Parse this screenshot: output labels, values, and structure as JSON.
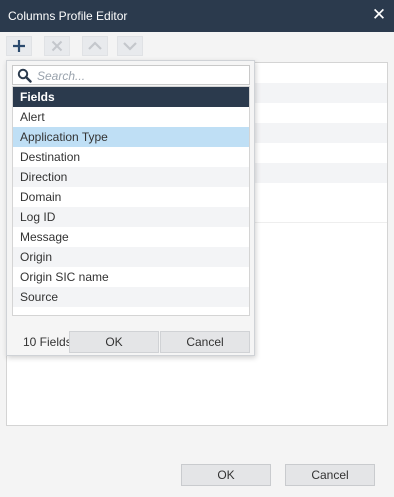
{
  "window": {
    "title": "Columns Profile Editor",
    "close_glyph": "✕"
  },
  "toolbar": {
    "buttons": [
      {
        "name": "add-icon",
        "enabled": true
      },
      {
        "name": "remove-icon",
        "enabled": false
      },
      {
        "name": "move-up-icon",
        "enabled": false
      },
      {
        "name": "move-down-icon",
        "enabled": false
      }
    ]
  },
  "popup": {
    "search": {
      "placeholder": "Search...",
      "value": ""
    },
    "list_header": "Fields",
    "fields": [
      "Alert",
      "Application Type",
      "Destination",
      "Direction",
      "Domain",
      "Log ID",
      "Message",
      "Origin",
      "Origin SIC name",
      "Source"
    ],
    "selected_field": "Application Type",
    "count_label": "10 Fields",
    "ok_label": "OK",
    "cancel_label": "Cancel"
  },
  "footer": {
    "ok_label": "OK",
    "cancel_label": "Cancel"
  },
  "colors": {
    "titlebar": "#2b3a4d",
    "selection": "#bfdff5",
    "add_icon": "#2b4a6e",
    "disabled_icon": "#c4c7cc"
  }
}
